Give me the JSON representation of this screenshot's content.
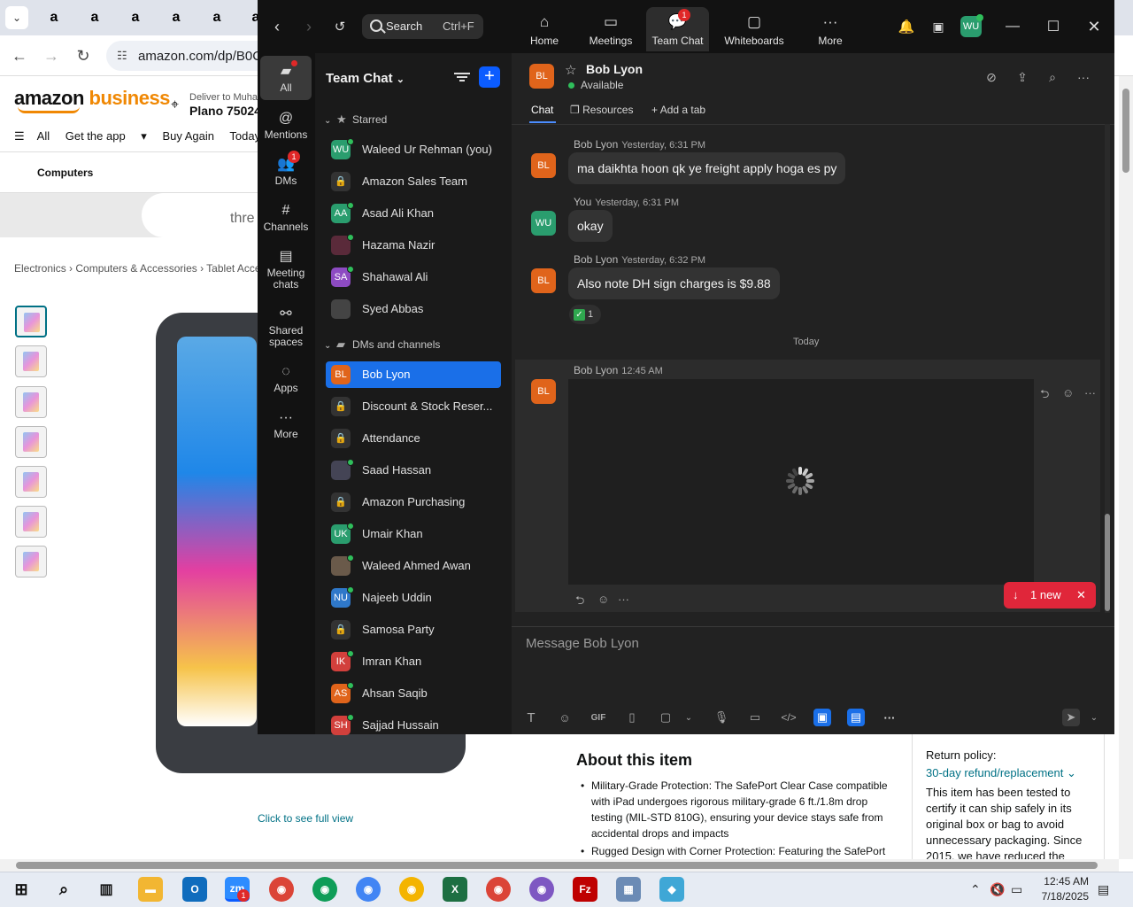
{
  "browser": {
    "tab_glyph": "a",
    "url": "amazon.com/dp/B0C",
    "amazon": {
      "logo_main": "amazon",
      "logo_accent": "business",
      "deliver_line": "Deliver to Muhar",
      "zip": "Plano 75024",
      "nav_all": "All",
      "nav": [
        "Get the app",
        "Buy Again",
        "Today's De"
      ],
      "subnav": "Computers",
      "promo": "thre",
      "breadcrumb": "Electronics › Computers & Accessories › Tablet Accesso",
      "see_full_view": "Click to see full view",
      "about_title": "About this item",
      "about_bullets": [
        "Military-Grade Protection: The SafePort Clear Case compatible with iPad undergoes rigorous military-grade 6 ft./1.8m drop testing (MIL-STD 810G), ensuring your device stays safe from accidental drops and impacts",
        "Rugged Design with Corner Protection: Featuring the SafePort"
      ],
      "return_policy_label": "Return policy:",
      "return_policy_link": "30-day refund/replacement",
      "return_body": "This item has been tested to certify it can ship safely in its original box or bag to avoid unnecessary packaging. Since 2015, we have reduced the"
    }
  },
  "zoom": {
    "search": {
      "label": "Search",
      "shortcut": "Ctrl+F"
    },
    "top_tabs": [
      {
        "label": "Home",
        "icon": "home-icon"
      },
      {
        "label": "Meetings",
        "icon": "video-icon"
      },
      {
        "label": "Team Chat",
        "icon": "chat-icon",
        "badge": "1"
      },
      {
        "label": "Whiteboards",
        "icon": "whiteboard-icon"
      },
      {
        "label": "More",
        "icon": "more-icon"
      }
    ],
    "profile_initials": "WU",
    "rail": [
      {
        "label": "All",
        "icon": "chat-bubble-icon"
      },
      {
        "label": "Mentions",
        "icon": "at-icon"
      },
      {
        "label": "DMs",
        "icon": "people-icon",
        "badge": "1"
      },
      {
        "label": "Channels",
        "icon": "hash-icon"
      },
      {
        "label": "Meeting chats",
        "icon": "calendar-icon"
      },
      {
        "label": "Shared spaces",
        "icon": "share-icon"
      },
      {
        "label": "Apps",
        "icon": "apps-icon"
      },
      {
        "label": "More",
        "icon": "more-icon"
      }
    ],
    "list_title": "Team Chat",
    "starred_label": "Starred",
    "dms_label": "DMs and channels",
    "starred": [
      {
        "name": "Waleed Ur Rehman (you)",
        "initials": "WU",
        "color": "#2a9d6e",
        "online": true
      },
      {
        "name": "Amazon Sales Team",
        "initials": "🔒",
        "lock": true
      },
      {
        "name": "Asad Ali Khan",
        "initials": "AA",
        "color": "#2a9d6e",
        "online": true
      },
      {
        "name": "Hazama Nazir",
        "initials": "",
        "color": "#5a2a3a",
        "online": true
      },
      {
        "name": "Shahawal Ali",
        "initials": "SA",
        "color": "#8d4bc2",
        "online": true
      },
      {
        "name": "Syed Abbas",
        "initials": "",
        "color": "#444",
        "online": false
      }
    ],
    "channels": [
      {
        "name": "Bob Lyon",
        "initials": "BL",
        "color": "#e0641b",
        "online": false,
        "selected": true
      },
      {
        "name": "Discount & Stock Reser...",
        "initials": "🔒",
        "lock": true
      },
      {
        "name": "Attendance",
        "initials": "🔒",
        "lock": true
      },
      {
        "name": "Saad Hassan",
        "initials": "",
        "color": "#445",
        "online": true
      },
      {
        "name": "Amazon Purchasing",
        "initials": "🔒",
        "lock": true
      },
      {
        "name": "Umair Khan",
        "initials": "UK",
        "color": "#2a9d6e",
        "online": true
      },
      {
        "name": "Waleed Ahmed Awan",
        "initials": "",
        "color": "#6a5a4a",
        "online": true
      },
      {
        "name": "Najeeb Uddin",
        "initials": "NU",
        "color": "#2f78c9",
        "online": true
      },
      {
        "name": "Samosa Party",
        "initials": "🔒",
        "lock": true
      },
      {
        "name": "Imran Khan",
        "initials": "IK",
        "color": "#d2403c",
        "online": true
      },
      {
        "name": "Ahsan Saqib",
        "initials": "AS",
        "color": "#e0641b",
        "online": true
      },
      {
        "name": "Sajjad Hussain",
        "initials": "SH",
        "color": "#d2403c",
        "online": true
      }
    ],
    "chat": {
      "name": "Bob Lyon",
      "initials": "BL",
      "status": "Available",
      "tabs": [
        "Chat",
        "Resources",
        "Add a tab"
      ],
      "messages": [
        {
          "author": "Bob Lyon",
          "time": "Yesterday, 6:31 PM",
          "text": "ma daikhta hoon qk ye freight apply hoga es py",
          "initials": "BL",
          "color": "#e0641b"
        },
        {
          "author": "You",
          "time": "Yesterday, 6:31 PM",
          "text": "okay",
          "initials": "WU",
          "color": "#2a9d6e"
        },
        {
          "author": "Bob Lyon",
          "time": "Yesterday, 6:32 PM",
          "text": "Also note DH sign charges is $9.88",
          "initials": "BL",
          "color": "#e0641b"
        }
      ],
      "reaction_count": "1",
      "day_separator": "Today",
      "latest": {
        "author": "Bob Lyon",
        "time": "12:45 AM",
        "initials": "BL"
      },
      "new_pill": "1 new",
      "composer_placeholder": "Message Bob Lyon",
      "gif_label": "GIF"
    }
  },
  "taskbar": {
    "time": "12:45 AM",
    "date": "7/18/2025",
    "zoom_badge": "1"
  }
}
